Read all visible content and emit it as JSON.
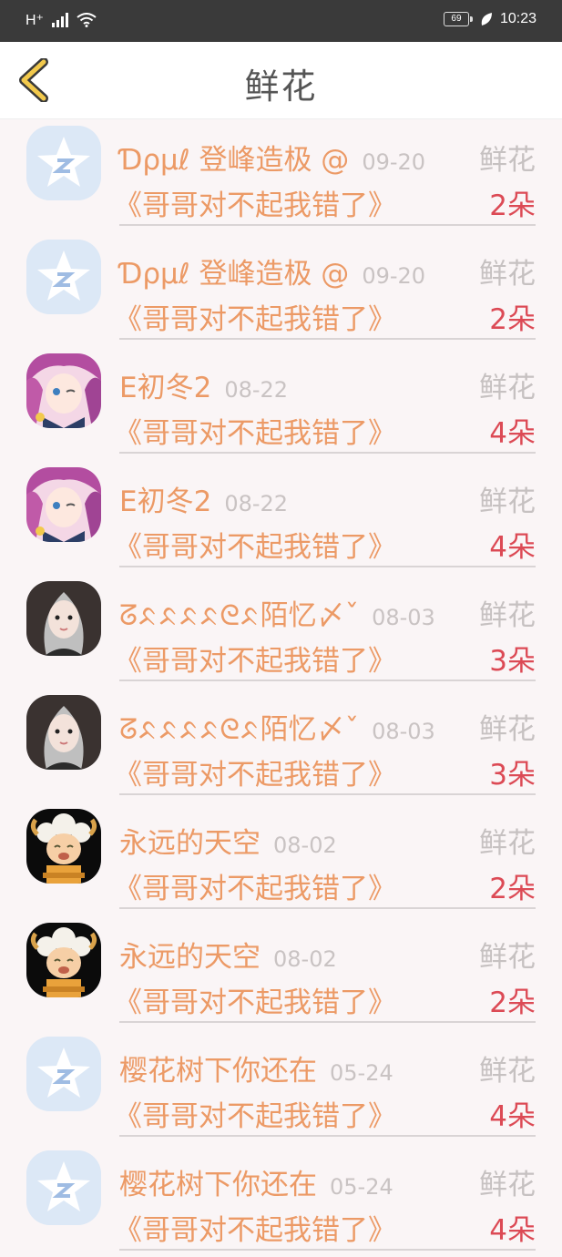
{
  "status_bar": {
    "network": "H⁺",
    "battery": "69",
    "time": "10:23"
  },
  "header": {
    "title": "鲜花"
  },
  "colors": {
    "accent": "#ec9a66",
    "count": "#dc4a55",
    "muted": "#c6c1c1",
    "back_icon": "#f2c94c"
  },
  "rows": [
    {
      "avatar": "qq-default-avatar",
      "user": "Ɗρµℓ 登峰造极 @",
      "date": "09-20",
      "gift": "鲜花",
      "song": "《哥哥对不起我错了》",
      "count": "2朵"
    },
    {
      "avatar": "qq-default-avatar",
      "user": "Ɗρµℓ 登峰造极 @",
      "date": "09-20",
      "gift": "鲜花",
      "song": "《哥哥对不起我错了》",
      "count": "2朵"
    },
    {
      "avatar": "anime-girl-avatar",
      "user": "E初冬2",
      "date": "08-22",
      "gift": "鲜花",
      "song": "《哥哥对不起我错了》",
      "count": "4朵"
    },
    {
      "avatar": "anime-girl-avatar",
      "user": "E初冬2",
      "date": "08-22",
      "gift": "鲜花",
      "song": "《哥哥对不起我错了》",
      "count": "4朵"
    },
    {
      "avatar": "photo-girl-avatar",
      "user": "ᘔᨅᨅᨅᨅᘓᨅ陌忆〆ˇ",
      "date": "08-03",
      "gift": "鲜花",
      "song": "《哥哥对不起我错了》",
      "count": "3朵"
    },
    {
      "avatar": "photo-girl-avatar",
      "user": "ᘔᨅᨅᨅᨅᘓᨅ陌忆〆ˇ",
      "date": "08-03",
      "gift": "鲜花",
      "song": "《哥哥对不起我错了》",
      "count": "3朵"
    },
    {
      "avatar": "cartoon-sheep-avatar",
      "user": "永远的天空",
      "date": "08-02",
      "gift": "鲜花",
      "song": "《哥哥对不起我错了》",
      "count": "2朵"
    },
    {
      "avatar": "cartoon-sheep-avatar",
      "user": "永远的天空",
      "date": "08-02",
      "gift": "鲜花",
      "song": "《哥哥对不起我错了》",
      "count": "2朵"
    },
    {
      "avatar": "qq-default-avatar",
      "user": "樱花树下你还在",
      "date": "05-24",
      "gift": "鲜花",
      "song": "《哥哥对不起我错了》",
      "count": "4朵"
    },
    {
      "avatar": "qq-default-avatar",
      "user": "樱花树下你还在",
      "date": "05-24",
      "gift": "鲜花",
      "song": "《哥哥对不起我错了》",
      "count": "4朵"
    }
  ]
}
